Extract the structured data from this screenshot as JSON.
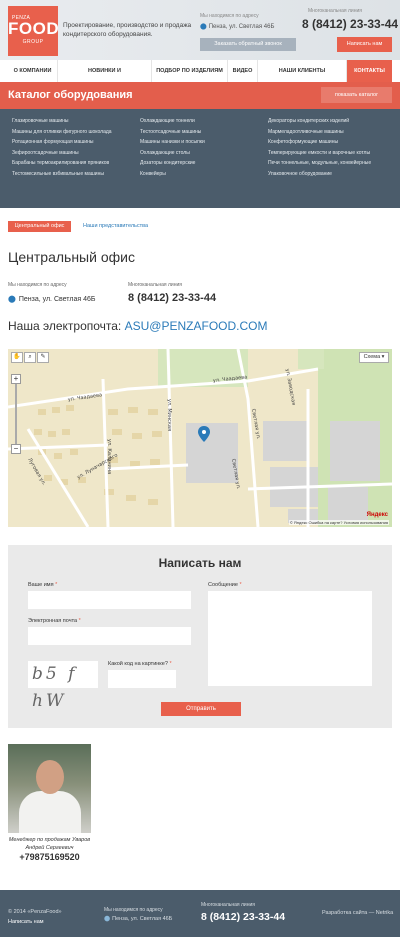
{
  "header": {
    "logo": {
      "small_top": "PENZA",
      "main": "FOOD",
      "small_bottom": "GROUP"
    },
    "tagline": "Проектирование, производство и продажа кондитерского оборудования.",
    "address_caption": "Мы находимся по адресу",
    "address": "Пенза, ул. Светлая 46Б",
    "callback_label": "Заказать обратный звонок",
    "phone_caption": "Многоканальная линия",
    "phone": "8 (8412) 23-33-44",
    "write_label": "Написать нам"
  },
  "nav": [
    {
      "label": "О компании"
    },
    {
      "label": "Новинки и спецпредложения"
    },
    {
      "label": "Подбор по изделиям"
    },
    {
      "label": "Видео"
    },
    {
      "label": "Наши клиенты"
    },
    {
      "label": "Контакты"
    }
  ],
  "catalog": {
    "title": "Каталог оборудования",
    "show_label": "показать каталог",
    "columns": [
      [
        "Глазировочные машины",
        "Машины для отливки фигурного шоколада",
        "Ротационная формующая машины",
        "Зефироотсадочные машины",
        "Барабаны термоакрилирования пряников",
        "Тестомесильные взбивальные машины"
      ],
      [
        "Охлаждающие тоннели",
        "Тестоотсадочные машины",
        "Машины нанизки и посыпки",
        "Охлаждающие столы",
        "Дозаторы кондитерские",
        "Конвейеры"
      ],
      [
        "Декораторы кондитерских изделий",
        "Мармеладоотливочные машины",
        "Конфетоформующие машины",
        "Темперирующие емкости и варочные котлы",
        "Печи тоннельные, модульные, конвейерные",
        "Упаковочное оборудование"
      ]
    ]
  },
  "tabs": {
    "active": "Центральный офис",
    "other": "Наши представительства"
  },
  "office": {
    "title": "Центральный офис",
    "address_caption": "Мы находимся по адресу",
    "address": "Пенза, ул. Светлая 46Б",
    "phone_caption": "Многоканальная линия",
    "phone": "8 (8412) 23-33-44",
    "email_label": "Наша электропочта:",
    "email": "ASU@PENZAFOOD.COM"
  },
  "map": {
    "layer_label": "Схема ▾",
    "brand": "Яндекс",
    "copyright": "© Яндекс  Ошибка на карте?  Условия использования",
    "streets": [
      "ул. Чаадаева",
      "ул. Чаадаева",
      "ул. Калинина",
      "Светлая ул.",
      "Светлая ул.",
      "ул. Заводская",
      "ул. Минская",
      "Луговая ул.",
      "ул. Луначарского"
    ]
  },
  "form": {
    "title": "Написать нам",
    "name_label": "Ваше имя",
    "email_label": "Электронная почта",
    "message_label": "Сообщение",
    "captcha_label": "Какой код на картинке?",
    "captcha_image_text": "b5 f hW",
    "required_mark": "*",
    "submit_label": "Отправить"
  },
  "manager": {
    "caption": "Менеджер по продажам Уваров Андрей Сергеевич",
    "phone": "+79875169520"
  },
  "footer": {
    "copyright": "© 2014 «PenzaFood»",
    "write_link": "Написать нам",
    "address_caption": "Мы находимся по адресу",
    "address": "Пенза, ул. Светлая 46Б",
    "phone_caption": "Многоканальная линия",
    "phone": "8 (8412) 23-33-44",
    "developer": "Разработка сайта — Netrika"
  },
  "colors": {
    "accent": "#e8604c",
    "dark": "#4b5c6b",
    "link": "#2a7ab8"
  }
}
